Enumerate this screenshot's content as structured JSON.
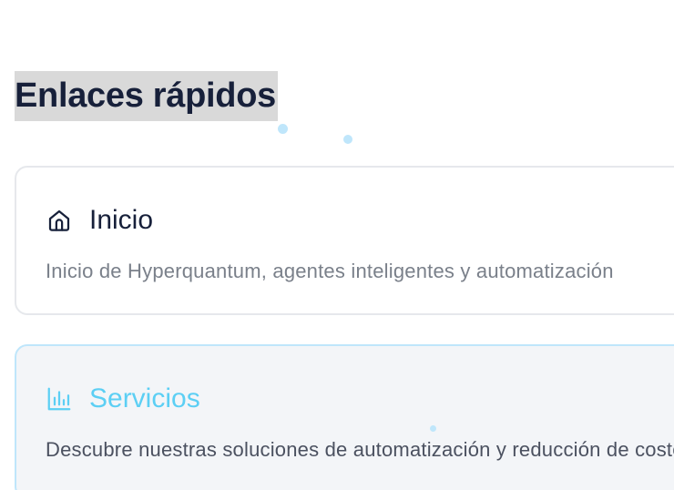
{
  "quick_links": {
    "title": "Enlaces rápidos",
    "items": [
      {
        "label": "Inicio",
        "description": "Inicio de Hyperquantum, agentes inteligentes y automatización",
        "icon": "home-icon",
        "state": "default"
      },
      {
        "label": "Servicios",
        "description": "Descubre nuestras soluciones de automatización y reducción de costes",
        "icon": "bar-chart-icon",
        "state": "hover",
        "accent_color": "#5ccff4"
      }
    ]
  }
}
